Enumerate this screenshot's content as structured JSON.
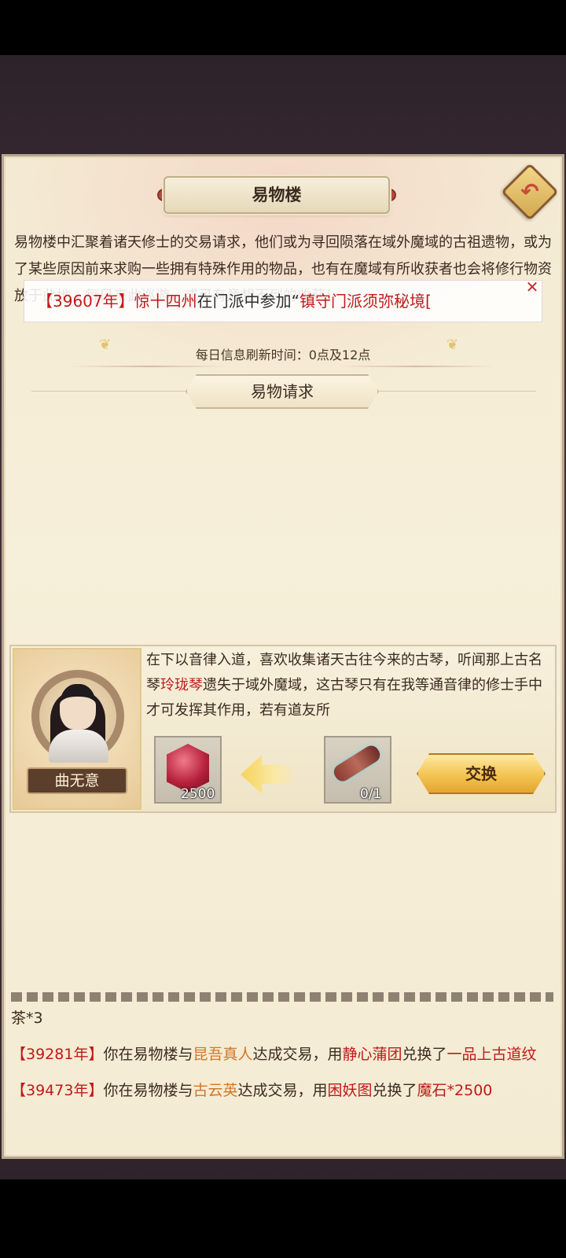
{
  "title": "易物楼",
  "back_icon": "undo-arrow-icon",
  "description": "易物楼中汇聚着诸天修士的交易请求，他们或为寻回陨落在域外魔域的古祖遗物，或为了某些原因前来求购一些拥有特殊作用的物品，也有在魔域有所收获者也会将修行物资放于此地，每日来此巡游，或可有意想不到的收获！",
  "marquee": {
    "year": "【39607年】",
    "player": "惊十四州",
    "text": "在门派中参加“",
    "event": "镇守门派须弥秘境[",
    "close_icon": "close-icon"
  },
  "refresh_text": "每日信息刷新时间：0点及12点",
  "section_title": "易物请求",
  "request": {
    "npc_name": "曲无意",
    "text_before": "在下以音律入道，喜欢收集诸天古往今来的古琴，听闻那上古名琴",
    "item_name": "玲珑琴",
    "text_after": "遗失于域外魔域，这古琴只有在我等通音律的修士手中才可发挥其作用，若有道友所",
    "reward_icon": "magic-stone-icon",
    "reward_count": "2500",
    "required_icon": "guqin-icon",
    "required_count": "0/1",
    "arrow_icon": "arrow-left-icon",
    "exchange_label": "交换"
  },
  "log": [
    {
      "line1": "茶*3"
    },
    {
      "year": "【39281年】",
      "t1": "你在易物楼与",
      "npc": "昆吾真人",
      "t2": "达成交易，用",
      "item": "静心蒲团",
      "t3": "兑换了",
      "reward": "一品上古道纹"
    },
    {
      "year": "【39473年】",
      "t1": "你在易物楼与",
      "npc": "古云英",
      "t2": "达成交易，用",
      "item": "困妖图",
      "t3": "兑换了",
      "reward": "魔石*2500"
    }
  ]
}
